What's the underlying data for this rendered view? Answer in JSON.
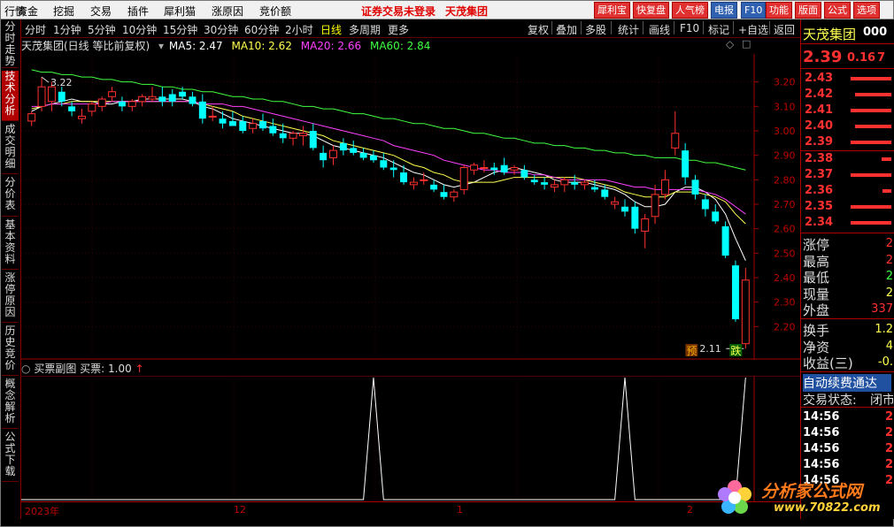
{
  "menubar": {
    "items": [
      "行情",
      "资金",
      "挖掘",
      "交易",
      "插件",
      "犀利猫",
      "涨原因",
      "竞价额"
    ],
    "notice": "证券交易未登录",
    "stock_title": "天茂集团",
    "tools": [
      {
        "label": "犀利宝",
        "color": "#e03030"
      },
      {
        "label": "快复盘",
        "color": "#e03030"
      },
      {
        "label": "人气榜",
        "color": "#e03030"
      },
      {
        "label": "电报",
        "color": "#3060b0"
      },
      {
        "label": "F10",
        "color": "#3060b0"
      },
      {
        "label": "功能",
        "color": "#e03030"
      },
      {
        "label": "版面",
        "color": "#e03030"
      },
      {
        "label": "公式",
        "color": "#e03030"
      },
      {
        "label": "选项",
        "color": "#e03030"
      }
    ]
  },
  "left_tabs": [
    "分时走势",
    "技术分析",
    "成交明细",
    "分价表",
    "基本资料",
    "涨停原因",
    "历史竞价",
    "概念解析",
    "公式下载"
  ],
  "active_left_tab": 1,
  "period_bar": {
    "periods": [
      "分时",
      "1分钟",
      "5分钟",
      "10分钟",
      "15分钟",
      "30分钟",
      "60分钟",
      "2小时",
      "日线",
      "多周期",
      "更多"
    ],
    "active": "日线",
    "actions": [
      "复权",
      "叠加",
      "多股",
      "统计",
      "画线",
      "F10",
      "标记",
      "+自选",
      "返回"
    ]
  },
  "chart_header": {
    "title": "天茂集团(日线 等比前复权)",
    "ma": [
      {
        "label": "MA5: 2.47",
        "color": "#ffffff"
      },
      {
        "label": "MA10: 2.62",
        "color": "#ffff50"
      },
      {
        "label": "MA20: 2.66",
        "color": "#ff40ff"
      },
      {
        "label": "MA60: 2.84",
        "color": "#40ff40"
      }
    ]
  },
  "sub_header": {
    "title": "买票副图",
    "value": "买票: 1.00"
  },
  "colors": {
    "up": "#ff3030",
    "down": "#00ffff",
    "accent": "#ff3030",
    "bg": "#000000",
    "grid": "#a00000"
  },
  "chart_data": {
    "type": "candlestick",
    "ylim": [
      2.1,
      3.3
    ],
    "yticks": [
      "3.20",
      "3.10",
      "3.00",
      "2.90",
      "2.80",
      "2.70",
      "2.60",
      "2.50",
      "2.40",
      "2.30",
      "2.20"
    ],
    "x_labels": [
      "2023年",
      "12",
      "1",
      "2"
    ],
    "annotations": {
      "high_label": "3.22",
      "low_label": "2.11",
      "tag_pre": "预",
      "tag_fall": "跌"
    },
    "candles": [
      {
        "o": 3.04,
        "h": 3.08,
        "l": 3.02,
        "c": 3.07
      },
      {
        "o": 3.1,
        "h": 3.22,
        "l": 3.08,
        "c": 3.18
      },
      {
        "o": 3.12,
        "h": 3.2,
        "l": 3.08,
        "c": 3.18
      },
      {
        "o": 3.16,
        "h": 3.18,
        "l": 3.1,
        "c": 3.12
      },
      {
        "o": 3.1,
        "h": 3.12,
        "l": 3.06,
        "c": 3.08
      },
      {
        "o": 3.05,
        "h": 3.09,
        "l": 3.03,
        "c": 3.06
      },
      {
        "o": 3.08,
        "h": 3.12,
        "l": 3.06,
        "c": 3.11
      },
      {
        "o": 3.1,
        "h": 3.14,
        "l": 3.08,
        "c": 3.13
      },
      {
        "o": 3.14,
        "h": 3.18,
        "l": 3.12,
        "c": 3.16
      },
      {
        "o": 3.12,
        "h": 3.14,
        "l": 3.08,
        "c": 3.1
      },
      {
        "o": 3.1,
        "h": 3.13,
        "l": 3.08,
        "c": 3.12
      },
      {
        "o": 3.12,
        "h": 3.15,
        "l": 3.1,
        "c": 3.14
      },
      {
        "o": 3.13,
        "h": 3.18,
        "l": 3.12,
        "c": 3.14
      },
      {
        "o": 3.14,
        "h": 3.18,
        "l": 3.1,
        "c": 3.12
      },
      {
        "o": 3.15,
        "h": 3.17,
        "l": 3.1,
        "c": 3.12
      },
      {
        "o": 3.16,
        "h": 3.18,
        "l": 3.13,
        "c": 3.14
      },
      {
        "o": 3.14,
        "h": 3.16,
        "l": 3.1,
        "c": 3.11
      },
      {
        "o": 3.12,
        "h": 3.15,
        "l": 3.03,
        "c": 3.05
      },
      {
        "o": 3.06,
        "h": 3.1,
        "l": 3.04,
        "c": 3.06
      },
      {
        "o": 3.05,
        "h": 3.08,
        "l": 3.01,
        "c": 3.03
      },
      {
        "o": 3.04,
        "h": 3.08,
        "l": 3.02,
        "c": 3.02
      },
      {
        "o": 3.04,
        "h": 3.06,
        "l": 2.99,
        "c": 3.0
      },
      {
        "o": 3.01,
        "h": 3.05,
        "l": 2.99,
        "c": 3.03
      },
      {
        "o": 3.04,
        "h": 3.07,
        "l": 3.0,
        "c": 3.01
      },
      {
        "o": 3.02,
        "h": 3.05,
        "l": 2.98,
        "c": 2.99
      },
      {
        "o": 2.99,
        "h": 3.03,
        "l": 2.95,
        "c": 2.97
      },
      {
        "o": 2.97,
        "h": 3.0,
        "l": 2.94,
        "c": 2.99
      },
      {
        "o": 2.98,
        "h": 3.02,
        "l": 2.94,
        "c": 2.99
      },
      {
        "o": 3.0,
        "h": 3.03,
        "l": 2.92,
        "c": 2.93
      },
      {
        "o": 2.91,
        "h": 2.94,
        "l": 2.85,
        "c": 2.88
      },
      {
        "o": 2.89,
        "h": 2.94,
        "l": 2.86,
        "c": 2.92
      },
      {
        "o": 2.95,
        "h": 2.97,
        "l": 2.9,
        "c": 2.92
      },
      {
        "o": 2.93,
        "h": 2.96,
        "l": 2.9,
        "c": 2.91
      },
      {
        "o": 2.91,
        "h": 2.93,
        "l": 2.88,
        "c": 2.89
      },
      {
        "o": 2.9,
        "h": 2.92,
        "l": 2.87,
        "c": 2.88
      },
      {
        "o": 2.88,
        "h": 2.91,
        "l": 2.84,
        "c": 2.85
      },
      {
        "o": 2.85,
        "h": 2.88,
        "l": 2.81,
        "c": 2.84
      },
      {
        "o": 2.83,
        "h": 2.86,
        "l": 2.78,
        "c": 2.79
      },
      {
        "o": 2.78,
        "h": 2.81,
        "l": 2.76,
        "c": 2.79
      },
      {
        "o": 2.8,
        "h": 2.83,
        "l": 2.78,
        "c": 2.8
      },
      {
        "o": 2.78,
        "h": 2.8,
        "l": 2.75,
        "c": 2.76
      },
      {
        "o": 2.75,
        "h": 2.78,
        "l": 2.72,
        "c": 2.73
      },
      {
        "o": 2.73,
        "h": 2.76,
        "l": 2.71,
        "c": 2.75
      },
      {
        "o": 2.76,
        "h": 2.86,
        "l": 2.74,
        "c": 2.85
      },
      {
        "o": 2.84,
        "h": 2.87,
        "l": 2.82,
        "c": 2.86
      },
      {
        "o": 2.85,
        "h": 2.88,
        "l": 2.83,
        "c": 2.85
      },
      {
        "o": 2.85,
        "h": 2.87,
        "l": 2.82,
        "c": 2.84
      },
      {
        "o": 2.86,
        "h": 2.89,
        "l": 2.82,
        "c": 2.83
      },
      {
        "o": 2.84,
        "h": 2.86,
        "l": 2.82,
        "c": 2.85
      },
      {
        "o": 2.84,
        "h": 2.86,
        "l": 2.8,
        "c": 2.81
      },
      {
        "o": 2.8,
        "h": 2.82,
        "l": 2.78,
        "c": 2.79
      },
      {
        "o": 2.79,
        "h": 2.81,
        "l": 2.76,
        "c": 2.78
      },
      {
        "o": 2.77,
        "h": 2.8,
        "l": 2.75,
        "c": 2.78
      },
      {
        "o": 2.78,
        "h": 2.81,
        "l": 2.75,
        "c": 2.8
      },
      {
        "o": 2.79,
        "h": 2.82,
        "l": 2.76,
        "c": 2.78
      },
      {
        "o": 2.78,
        "h": 2.8,
        "l": 2.76,
        "c": 2.79
      },
      {
        "o": 2.77,
        "h": 2.8,
        "l": 2.75,
        "c": 2.76
      },
      {
        "o": 2.76,
        "h": 2.78,
        "l": 2.72,
        "c": 2.73
      },
      {
        "o": 2.7,
        "h": 2.73,
        "l": 2.68,
        "c": 2.71
      },
      {
        "o": 2.69,
        "h": 2.72,
        "l": 2.65,
        "c": 2.67
      },
      {
        "o": 2.69,
        "h": 2.71,
        "l": 2.58,
        "c": 2.6
      },
      {
        "o": 2.59,
        "h": 2.66,
        "l": 2.52,
        "c": 2.64
      },
      {
        "o": 2.65,
        "h": 2.78,
        "l": 2.62,
        "c": 2.74
      },
      {
        "o": 2.74,
        "h": 2.84,
        "l": 2.72,
        "c": 2.8
      },
      {
        "o": 2.93,
        "h": 3.08,
        "l": 2.9,
        "c": 2.99
      },
      {
        "o": 2.92,
        "h": 2.95,
        "l": 2.78,
        "c": 2.81
      },
      {
        "o": 2.8,
        "h": 2.82,
        "l": 2.72,
        "c": 2.74
      },
      {
        "o": 2.72,
        "h": 2.74,
        "l": 2.65,
        "c": 2.68
      },
      {
        "o": 2.67,
        "h": 2.7,
        "l": 2.62,
        "c": 2.63
      },
      {
        "o": 2.61,
        "h": 2.63,
        "l": 2.48,
        "c": 2.49
      },
      {
        "o": 2.45,
        "h": 2.47,
        "l": 2.22,
        "c": 2.23
      },
      {
        "o": 2.13,
        "h": 2.44,
        "l": 2.11,
        "c": 2.39
      }
    ],
    "ma_series": [
      {
        "name": "MA5",
        "color": "#ffffff",
        "values": [
          3.08,
          3.1,
          3.11,
          3.12,
          3.13,
          3.12,
          3.12,
          3.11,
          3.11,
          3.12,
          3.12,
          3.13,
          3.13,
          3.13,
          3.13,
          3.13,
          3.12,
          3.1,
          3.09,
          3.07,
          3.05,
          3.04,
          3.03,
          3.02,
          3.01,
          3.0,
          2.99,
          2.99,
          2.98,
          2.96,
          2.94,
          2.93,
          2.92,
          2.91,
          2.9,
          2.89,
          2.87,
          2.85,
          2.83,
          2.82,
          2.8,
          2.78,
          2.77,
          2.78,
          2.79,
          2.81,
          2.83,
          2.84,
          2.85,
          2.84,
          2.83,
          2.82,
          2.8,
          2.79,
          2.79,
          2.79,
          2.78,
          2.77,
          2.76,
          2.74,
          2.71,
          2.69,
          2.69,
          2.7,
          2.75,
          2.77,
          2.77,
          2.75,
          2.72,
          2.66,
          2.56,
          2.47
        ]
      },
      {
        "name": "MA10",
        "color": "#ffff50",
        "values": [
          3.09,
          3.1,
          3.11,
          3.11,
          3.12,
          3.12,
          3.12,
          3.12,
          3.12,
          3.12,
          3.12,
          3.12,
          3.12,
          3.12,
          3.12,
          3.12,
          3.12,
          3.11,
          3.1,
          3.09,
          3.08,
          3.06,
          3.05,
          3.04,
          3.03,
          3.02,
          3.01,
          3.0,
          2.99,
          2.98,
          2.96,
          2.95,
          2.94,
          2.93,
          2.92,
          2.91,
          2.9,
          2.88,
          2.86,
          2.85,
          2.83,
          2.82,
          2.8,
          2.79,
          2.79,
          2.79,
          2.79,
          2.8,
          2.81,
          2.81,
          2.81,
          2.81,
          2.81,
          2.81,
          2.81,
          2.8,
          2.79,
          2.78,
          2.77,
          2.75,
          2.74,
          2.73,
          2.73,
          2.73,
          2.75,
          2.75,
          2.75,
          2.74,
          2.73,
          2.71,
          2.66,
          2.62
        ]
      },
      {
        "name": "MA20",
        "color": "#ff40ff",
        "values": [
          3.1,
          3.1,
          3.11,
          3.11,
          3.11,
          3.11,
          3.11,
          3.11,
          3.12,
          3.12,
          3.12,
          3.12,
          3.12,
          3.12,
          3.12,
          3.12,
          3.12,
          3.11,
          3.11,
          3.11,
          3.1,
          3.1,
          3.09,
          3.08,
          3.07,
          3.06,
          3.05,
          3.04,
          3.03,
          3.02,
          3.01,
          3.0,
          2.99,
          2.98,
          2.97,
          2.96,
          2.94,
          2.93,
          2.92,
          2.91,
          2.9,
          2.88,
          2.87,
          2.86,
          2.85,
          2.84,
          2.84,
          2.83,
          2.83,
          2.83,
          2.82,
          2.82,
          2.81,
          2.8,
          2.8,
          2.8,
          2.8,
          2.8,
          2.79,
          2.78,
          2.77,
          2.77,
          2.76,
          2.76,
          2.76,
          2.76,
          2.76,
          2.75,
          2.74,
          2.72,
          2.69,
          2.66
        ]
      },
      {
        "name": "MA60",
        "color": "#40ff40",
        "values": [
          3.25,
          3.24,
          3.24,
          3.23,
          3.23,
          3.22,
          3.22,
          3.21,
          3.21,
          3.2,
          3.2,
          3.19,
          3.19,
          3.18,
          3.18,
          3.17,
          3.17,
          3.16,
          3.16,
          3.15,
          3.14,
          3.14,
          3.13,
          3.13,
          3.12,
          3.12,
          3.11,
          3.1,
          3.1,
          3.09,
          3.09,
          3.08,
          3.07,
          3.07,
          3.06,
          3.05,
          3.05,
          3.04,
          3.03,
          3.03,
          3.02,
          3.01,
          3.01,
          3.0,
          2.99,
          2.99,
          2.98,
          2.97,
          2.97,
          2.96,
          2.95,
          2.95,
          2.94,
          2.94,
          2.93,
          2.93,
          2.92,
          2.92,
          2.91,
          2.91,
          2.9,
          2.9,
          2.89,
          2.89,
          2.89,
          2.88,
          2.88,
          2.87,
          2.87,
          2.86,
          2.85,
          2.84
        ]
      }
    ],
    "sub_signal_peaks": [
      34,
      59,
      71
    ],
    "sub_signal_values_max": 1.0
  },
  "right_panel": {
    "stock_name": "天茂集团",
    "stock_code_partial": "000",
    "price": "2.39",
    "change": "0.16",
    "change_pct_partial": "7",
    "asks": [
      {
        "price": "2.43",
        "ratio": 0.95
      },
      {
        "price": "2.42",
        "ratio": 0.85
      },
      {
        "price": "2.41",
        "ratio": 0.95
      },
      {
        "price": "2.40",
        "ratio": 0.85
      },
      {
        "price": "2.39",
        "ratio": 0.95
      }
    ],
    "bids": [
      {
        "price": "2.38",
        "ratio": 0.22
      },
      {
        "price": "2.37",
        "ratio": 0.95
      },
      {
        "price": "2.36",
        "ratio": 0.2
      },
      {
        "price": "2.35",
        "ratio": 0.95
      },
      {
        "price": "2.34",
        "ratio": 0.95
      }
    ],
    "stats": [
      {
        "label": "涨停",
        "value": "2",
        "color": "#ff3030"
      },
      {
        "label": "最高",
        "value": "2",
        "color": "#ff3030"
      },
      {
        "label": "最低",
        "value": "2",
        "color": "#40ff40"
      },
      {
        "label": "现量",
        "value": "2",
        "color": "#ffff50"
      },
      {
        "label": "外盘",
        "value": "337",
        "color": "#ff3030"
      }
    ],
    "stats2": [
      {
        "label": "换手",
        "value": "1.2",
        "color": "#ffff50"
      },
      {
        "label": "净资",
        "value": "4",
        "color": "#ffff50"
      },
      {
        "label": "收益(三)",
        "value": "-0.",
        "color": "#ffff50"
      }
    ],
    "promo": "自动续费通达",
    "trade_status_label": "交易状态:",
    "trade_status_value": "闭市",
    "ticks": [
      {
        "time": "14:56",
        "value": "2"
      },
      {
        "time": "14:56",
        "value": "2"
      },
      {
        "time": "14:56",
        "value": "2"
      },
      {
        "time": "14:56",
        "value": "2"
      },
      {
        "time": "14:56",
        "value": "2"
      }
    ]
  },
  "watermark": {
    "title": "分析家公式网",
    "url": "www.70822.com"
  }
}
